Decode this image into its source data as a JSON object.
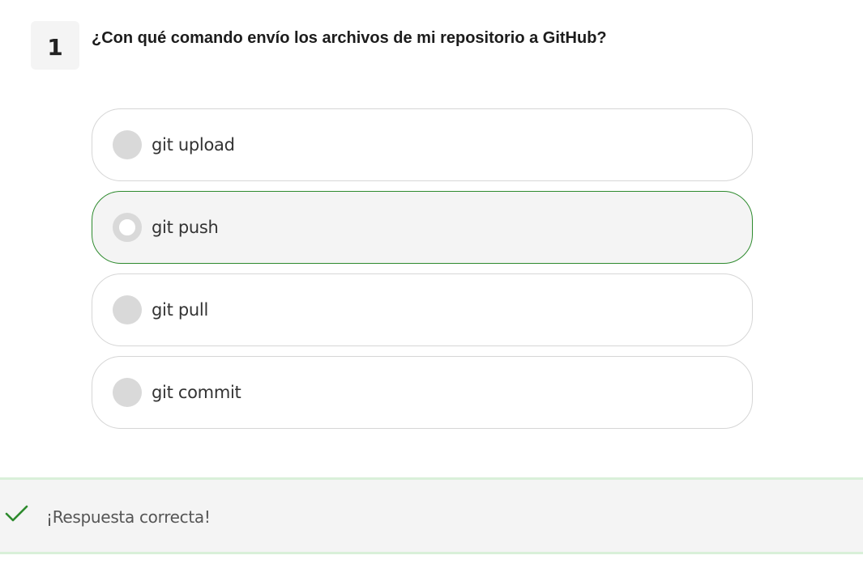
{
  "question": {
    "number": "1",
    "text": "¿Con qué comando envío los archivos de mi repositorio a GitHub?"
  },
  "options": [
    {
      "label": "git upload",
      "selected": false
    },
    {
      "label": "git push",
      "selected": true
    },
    {
      "label": "git pull",
      "selected": false
    },
    {
      "label": "git commit",
      "selected": false
    }
  ],
  "feedback": {
    "icon": "checkmark-icon",
    "text": "¡Respuesta correcta!",
    "accent_color": "#2d8a2d"
  },
  "colors": {
    "selected_border": "#2d8a2d",
    "radio_fill": "#d9d9d9",
    "panel_bg": "#f4f4f4"
  }
}
